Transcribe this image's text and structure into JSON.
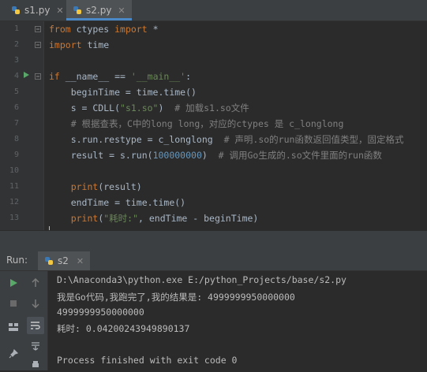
{
  "tabs": [
    {
      "label": "s1.py",
      "active": false
    },
    {
      "label": "s2.py",
      "active": true
    }
  ],
  "editor": {
    "line_numbers": [
      "1",
      "2",
      "3",
      "4",
      "5",
      "6",
      "7",
      "8",
      "9",
      "10",
      "11",
      "12",
      "13"
    ],
    "lines": {
      "l1_from": "from",
      "l1_mod": " ctypes ",
      "l1_import": "import",
      "l1_star": " *",
      "l2_import": "import",
      "l2_mod": " time",
      "l4_if": "if",
      "l4_a": " __name__ == ",
      "l4_str": "'__main__'",
      "l4_b": ":",
      "l5": "    beginTime = time.time()",
      "l6_a": "    s = CDLL(",
      "l6_str": "\"s1.so\"",
      "l6_b": ")  ",
      "l6_cm": "# 加载s1.so文件",
      "l7_cm": "    # 根据查表，C中的long long，对应的ctypes 是 c_longlong",
      "l8_a": "    s.run.restype = c_longlong  ",
      "l8_cm": "# 声明.so的run函数返回值类型，固定格式",
      "l9_a": "    result = s.run(",
      "l9_num": "100000000",
      "l9_b": ")  ",
      "l9_cm": "# 调用Go生成的.so文件里面的run函数",
      "l11_print": "    print",
      "l11_b": "(result)",
      "l12": "    endTime = time.time()",
      "l13_print": "    print",
      "l13_a": "(",
      "l13_str": "\"耗时:\"",
      "l13_b": ", endTime - beginTime)"
    }
  },
  "run_panel": {
    "label": "Run:",
    "tab_label": "s2",
    "console_lines": [
      "D:\\Anaconda3\\python.exe E:/python_Projects/base/s2.py",
      "我是Go代码,我跑完了,我的结果是: 4999999950000000",
      "4999999950000000",
      "耗时: 0.04200243949890137",
      "",
      "Process finished with exit code 0"
    ]
  },
  "colors": {
    "keyword": "#cc7832",
    "string": "#6a8759",
    "comment": "#808080",
    "number": "#6897bb",
    "run_green": "#59a869"
  },
  "icons": [
    "python-file-icon",
    "close-icon",
    "run-gutter-icon",
    "rerun-icon",
    "stop-icon",
    "up-arrow-icon",
    "down-arrow-icon",
    "soft-wrap-icon",
    "scroll-to-end-icon",
    "layout-icon",
    "print-icon",
    "pin-icon",
    "delete-icon"
  ]
}
